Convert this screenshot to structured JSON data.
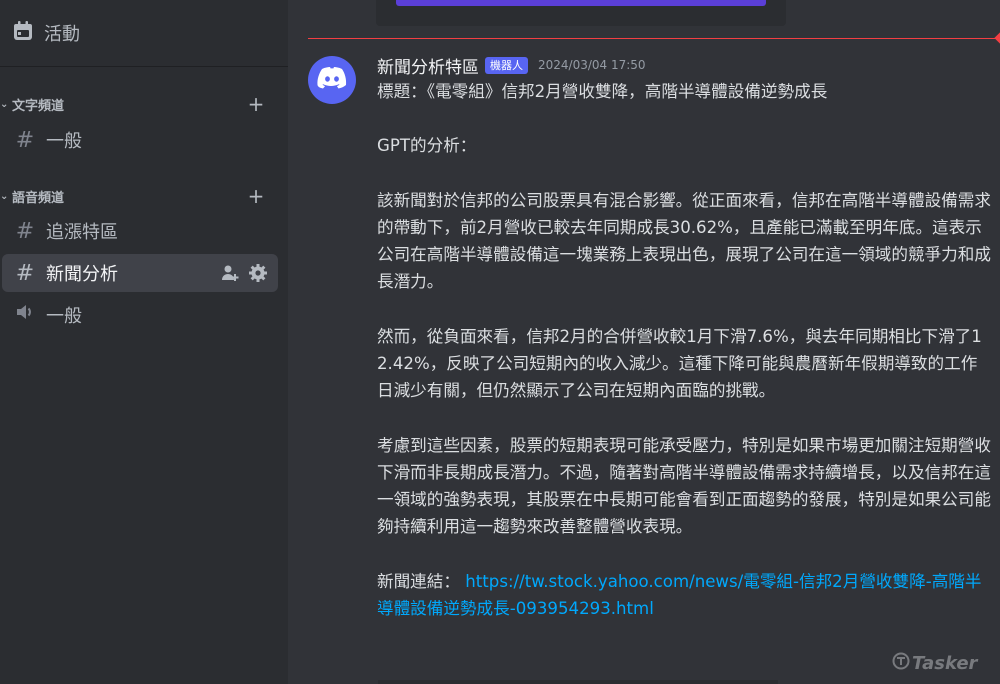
{
  "sidebar": {
    "events_label": "活動",
    "categories": [
      {
        "label": "文字頻道",
        "channels": [
          {
            "label": "一般",
            "icon": "hash-icon"
          }
        ]
      },
      {
        "label": "語音頻道",
        "channels": [
          {
            "label": "追漲特區",
            "icon": "hash-icon"
          },
          {
            "label": "新聞分析",
            "icon": "hash-icon",
            "active": true
          },
          {
            "label": "一般",
            "icon": "speaker-icon"
          }
        ]
      }
    ]
  },
  "message": {
    "author": "新聞分析特區",
    "badge": "機器人",
    "timestamp": "2024/03/04 17:50",
    "paragraphs": [
      "標題：《電零組》信邦2月營收雙降，高階半導體設備逆勢成長",
      "GPT的分析：",
      "該新聞對於信邦的公司股票具有混合影響。從正面來看，信邦在高階半導體設備需求的帶動下，前2月營收已較去年同期成長30.62%，且產能已滿載至明年底。這表示公司在高階半導體設備這一塊業務上表現出色，展現了公司在這一領域的競爭力和成長潛力。",
      "然而，從負面來看，信邦2月的合併營收較1月下滑7.6%，與去年同期相比下滑了12.42%，反映了公司短期內的收入減少。這種下降可能與農曆新年假期導致的工作日減少有關，但仍然顯示了公司在短期內面臨的挑戰。",
      "考慮到這些因素，股票的短期表現可能承受壓力，特別是如果市場更加關注短期營收下滑而非長期成長潛力。不過，隨著對高階半導體設備需求持續增長，以及信邦在這一領域的強勢表現，其股票在中長期可能會看到正面趨勢的發展，特別是如果公司能夠持續利用這一趨勢來改善整體營收表現。"
    ],
    "link_label": "新聞連結：",
    "link_url": "https://tw.stock.yahoo.com/news/電零組-信邦2月營收雙降-高階半導體設備逆勢成長-093954293.html"
  },
  "watermark": "Tasker",
  "colors": {
    "accent": "#5865f2",
    "link": "#00a8fc",
    "new_marker": "#f23f43"
  }
}
